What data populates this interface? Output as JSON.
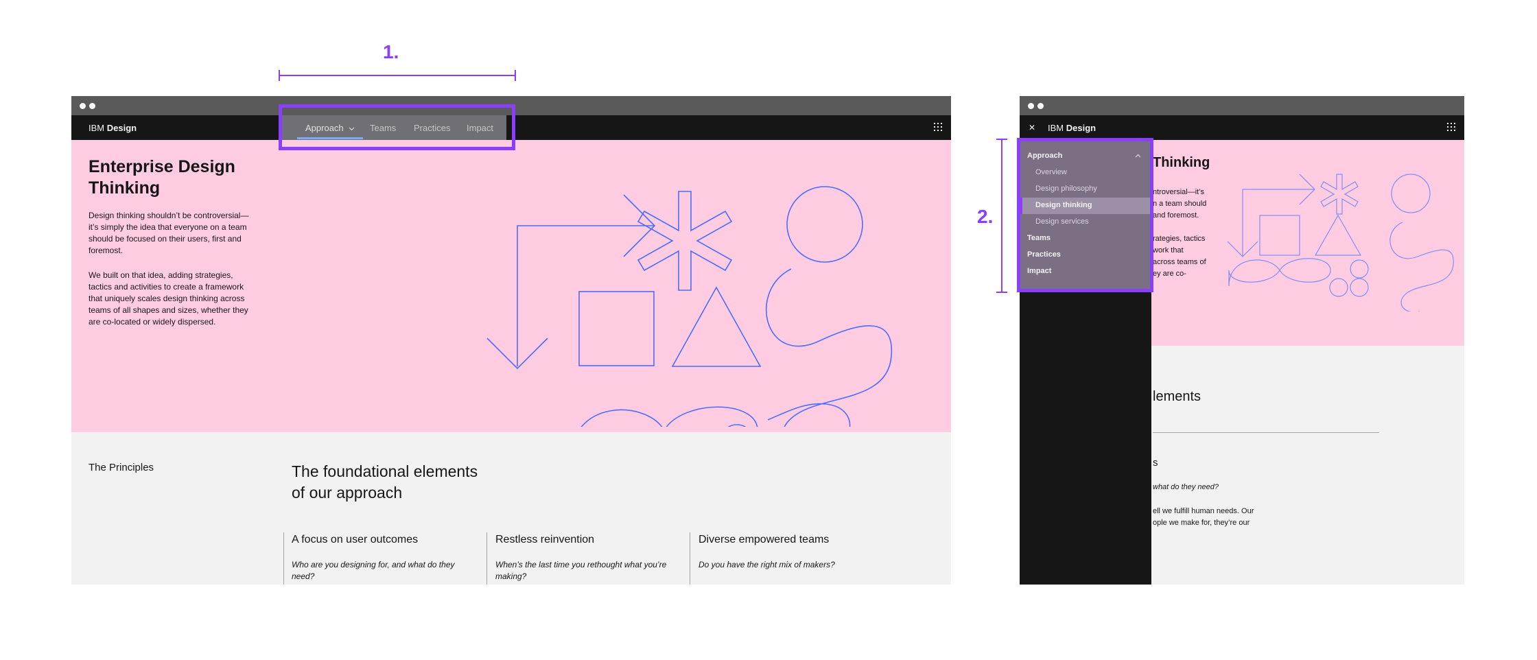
{
  "annotations": {
    "one": "1.",
    "two": "2."
  },
  "desktop": {
    "brand": {
      "prefix": "IBM",
      "name": "Design"
    },
    "nav": {
      "approach": "Approach",
      "teams": "Teams",
      "practices": "Practices",
      "impact": "Impact"
    },
    "hero": {
      "title_line1": "Enterprise Design",
      "title_line2": "Thinking",
      "para1": "Design thinking shouldn’t be controversial—it’s simply the idea that everyone on a team should be focused on their users, first and foremost.",
      "para2": "We built on that idea, adding strategies, tactics and activities to create a framework that uniquely scales design thinking across teams of all shapes and sizes, whether they are co-located or widely dispersed."
    },
    "principles": {
      "label": "The Principles",
      "heading_line1": "The foundational elements",
      "heading_line2": "of our approach",
      "columns": [
        {
          "title": "A focus on user outcomes",
          "question": "Who are you designing for, and what do they need?"
        },
        {
          "title": "Restless reinvention",
          "question": "When’s the last time you rethought what you’re making?"
        },
        {
          "title": "Diverse empowered teams",
          "question": "Do you have the right mix of makers?"
        }
      ]
    }
  },
  "mobile": {
    "close_symbol": "✕",
    "brand": {
      "prefix": "IBM",
      "name": "Design"
    },
    "sidenav": {
      "approach": "Approach",
      "overview": "Overview",
      "philosophy": "Design philosophy",
      "thinking": "Design thinking",
      "services": "Design services",
      "teams": "Teams",
      "practices": "Practices",
      "impact": "Impact"
    },
    "peek": {
      "title": "Thinking",
      "l1": "ntroversial—it’s",
      "l2": "n a team should",
      "l3": "and foremost.",
      "l4": "rategies, tactics",
      "l5": "work that",
      "l6": "across teams of",
      "l7": "ey are co-",
      "heading": "lements",
      "sub": "s",
      "q": "what do they need?",
      "b1": "ell we fulfill human needs. Our",
      "b2": "ople we make for, they’re our"
    }
  },
  "colors": {
    "accent": "#8a3ffc",
    "hero_bg": "#ffcce1",
    "shapes": "#4a6dfb",
    "masthead": "#161616"
  }
}
